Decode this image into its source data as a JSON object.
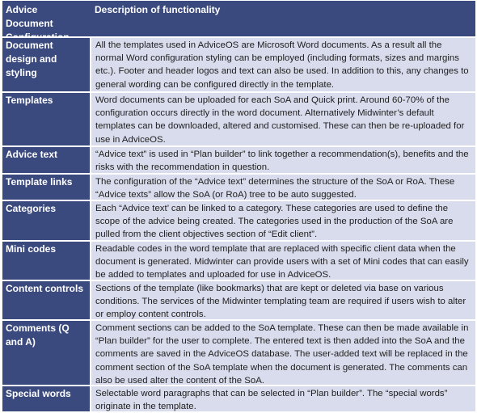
{
  "table": {
    "header": {
      "col1": "Advice Document Configuration",
      "col2": "Description of functionality"
    },
    "rows": [
      {
        "name": "Document design and styling",
        "description": "All the templates used in AdviceOS are Microsoft Word documents. As a result all the normal Word configuration styling can be employed (including formats, sizes and margins etc.). Footer and header logos and text can also be used. In addition to this, any changes to general wording can be configured directly in the template."
      },
      {
        "name": "Templates",
        "description": "Word documents can be uploaded for each SoA and Quick print. Around 60-70% of the configuration occurs directly in the word document. Alternatively Midwinter’s default templates can be downloaded, altered and customised. These can then be re-uploaded for use in AdviceOS."
      },
      {
        "name": "Advice text",
        "description": "“Advice text” is used in “Plan builder” to link together a recommendation(s), benefits and the risks with the recommendation in question."
      },
      {
        "name": "Template links",
        "description": "The configuration of the “Advice text” determines the structure of the SoA or RoA. These “Advice texts” allow the SoA (or RoA) tree to be auto suggested."
      },
      {
        "name": "Categories",
        "description": "Each “Advice text’ can be linked to a category. These categories are used to define the scope of the advice being created. The categories used in the production of the SoA are pulled from the client objectives section of “Edit client”."
      },
      {
        "name": "Mini codes",
        "description": "Readable codes in the word template that are replaced with specific client data when the document is generated. Midwinter can provide users with a set of Mini codes that can easily be added to templates and uploaded for use in AdviceOS."
      },
      {
        "name": "Content controls",
        "description": "Sections of the template (like bookmarks) that are kept or deleted via base on various conditions. The services of the Midwinter templating team are required if users wish to alter or employ content controls."
      },
      {
        "name": "Comments (Q and A)",
        "description": "Comment sections can be added to the SoA template. These can then be made available in “Plan builder” for the user to complete. The entered text is then added into the SoA and the comments are saved in the AdviceOS database. The user-added text will be replaced in the comment section of the SoA template when the document is generated. The comments can also be used alter the content of the SoA."
      },
      {
        "name": "Special words",
        "description": "Selectable word paragraphs that can be selected in “Plan builder”. The “special words” originate in the template."
      }
    ]
  },
  "colors": {
    "header_bg": "#3b4a7e",
    "cell_bg": "#d9dcec",
    "separator": "#ffffff"
  }
}
